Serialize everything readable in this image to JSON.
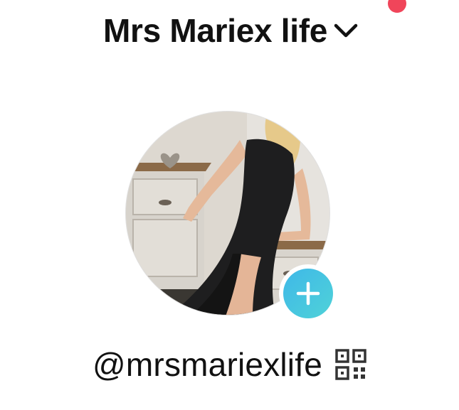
{
  "header": {
    "account_name": "Mrs Mariex life",
    "dropdown_icon": "chevron-down-icon",
    "notification_dot_color": "#f0455a"
  },
  "profile": {
    "avatar": "profile-photo",
    "follow_icon": "plus-icon",
    "follow_badge_color": "#3fb8e8",
    "handle": "@mrsmariexlife",
    "qr_icon": "qr-code-icon"
  }
}
